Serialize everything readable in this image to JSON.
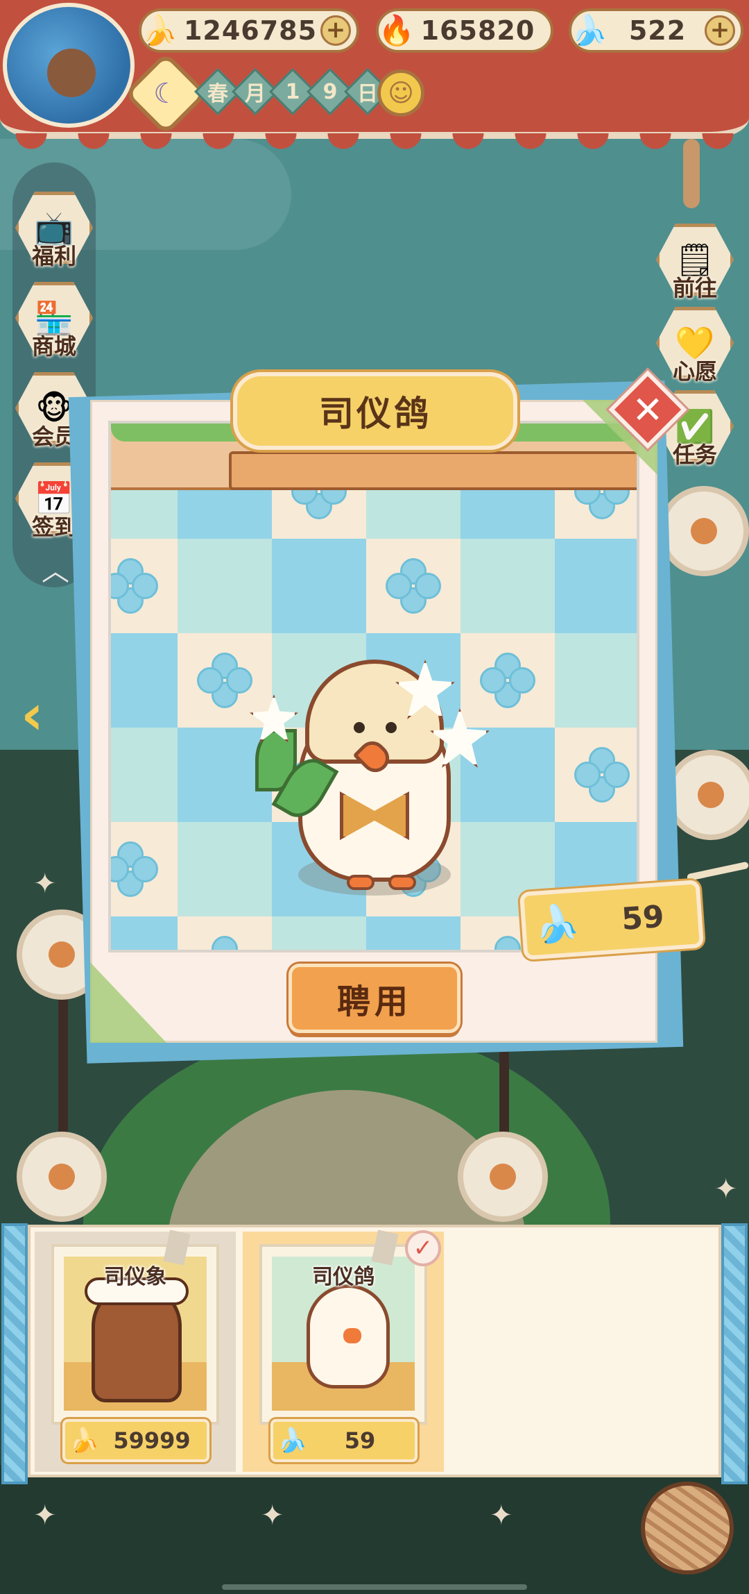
{
  "colors": {
    "banner": "#c2503f",
    "card": "#fbeee6",
    "accent_gold": "#f6d168",
    "hire_button": "#f2a14e",
    "close_button": "#e0564a"
  },
  "header": {
    "avatar_icon": "player-avatar-icon",
    "currencies": [
      {
        "icon": "banana-icon",
        "glyph": "🍌",
        "value": "1246785"
      },
      {
        "icon": "flame-icon",
        "glyph": "🔥",
        "value": "165820"
      },
      {
        "icon": "blue-banana-icon",
        "glyph": "🍌",
        "value": "522"
      }
    ],
    "plus": "+",
    "moon_glyph": "☾",
    "date_chars": [
      "春",
      "月",
      "1",
      "9",
      "日"
    ],
    "weather_glyph": "☺"
  },
  "left_menu": [
    {
      "label": "福利",
      "icon": "tv-icon",
      "glyph": "📺"
    },
    {
      "label": "商城",
      "icon": "shop-icon",
      "glyph": "🏪"
    },
    {
      "label": "会员",
      "icon": "member-icon",
      "glyph": "🐵"
    },
    {
      "label": "签到",
      "icon": "calendar-icon",
      "glyph": "📅"
    }
  ],
  "collapse_glyph": "︿",
  "left_arrow_glyph": "‹",
  "right_menu": [
    {
      "label": "前往",
      "icon": "board-icon",
      "glyph": "🗒"
    },
    {
      "label": "心愿",
      "icon": "heart-book-icon",
      "glyph": "💛"
    },
    {
      "label": "任务",
      "icon": "task-icon",
      "glyph": "✅"
    }
  ],
  "popup": {
    "title": "司仪鸽",
    "close_glyph": "✕",
    "price_icon": "blue-banana-icon",
    "price_glyph": "🍌",
    "price": "59",
    "hire_label": "聘用"
  },
  "tray": {
    "items": [
      {
        "name": "司仪象",
        "currency_icon": "banana-icon",
        "glyph": "🍌",
        "price": "59999",
        "selected": false
      },
      {
        "name": "司仪鸽",
        "currency_icon": "blue-banana-icon",
        "glyph": "🍌",
        "price": "59",
        "selected": true
      }
    ],
    "check_glyph": "✓"
  }
}
